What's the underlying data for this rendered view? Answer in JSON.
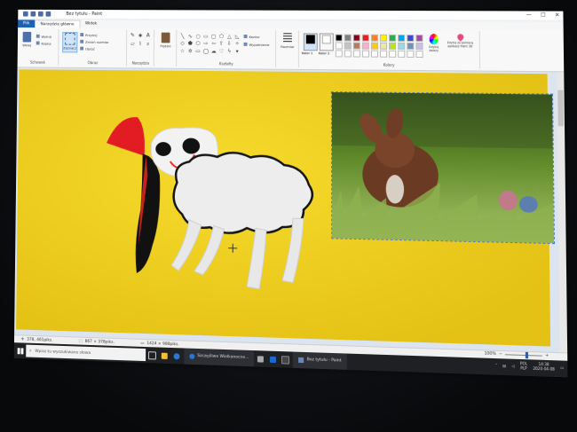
{
  "window": {
    "title": "Bez tytułu - Paint",
    "minimize_glyph": "—",
    "maximize_glyph": "☐",
    "close_glyph": "✕"
  },
  "tabs": [
    {
      "label": "Plik"
    },
    {
      "label": "Narzędzia główne"
    },
    {
      "label": "Widok"
    }
  ],
  "ribbon": {
    "clipboard": {
      "paste_label": "Wklej",
      "cut_label": "Wytnij",
      "copy_label": "Kopiuj",
      "group_label": "Schowek"
    },
    "image": {
      "select_label": "Zaznacz",
      "crop_label": "Przytnij",
      "resize_label": "Zmień rozmiar",
      "rotate_label": "Obróć",
      "group_label": "Obraz"
    },
    "tools": {
      "group_label": "Narzędzia"
    },
    "brushes": {
      "label": "Pędzle"
    },
    "shapes": {
      "outline_label": "Kontur",
      "fill_label": "Wypełnienie",
      "group_label": "Kształty"
    },
    "size": {
      "label": "Rozmiar"
    },
    "colors": {
      "color1_label": "Kolor 1",
      "color2_label": "Kolor 2",
      "edit_label": "Edytuj kolory",
      "paint3d_label": "Edytuj za pomocą aplikacji Paint 3D",
      "group_label": "Kolory",
      "color1": "#000000",
      "color2": "#ffffff",
      "palette": [
        "#000000",
        "#7f7f7f",
        "#880015",
        "#ed1c24",
        "#ff7f27",
        "#fff200",
        "#22b14c",
        "#00a2e8",
        "#3f48cc",
        "#a349a4",
        "#ffffff",
        "#c3c3c3",
        "#b97a57",
        "#ffaec9",
        "#ffc90e",
        "#efe4b0",
        "#b5e61d",
        "#99d9ea",
        "#7092be",
        "#c8bfe7",
        "#ffffff",
        "#ffffff",
        "#ffffff",
        "#ffffff",
        "#ffffff",
        "#ffffff",
        "#ffffff",
        "#ffffff",
        "#ffffff",
        "#ffffff"
      ]
    }
  },
  "canvas": {
    "background": "#f2d21f"
  },
  "status": {
    "cursor_pos": "378, 461piks.",
    "selection_size": "867 × 378piks.",
    "image_size": "1424 × 988piks.",
    "zoom": "100%"
  },
  "taskbar": {
    "search_placeholder": "Wpisz tu wyszukiwane słowa",
    "browser_app": "Szczęśliwe Wielkanocne...",
    "paint_app": "Bez tytułu - Paint",
    "lang_top": "POL",
    "lang_bottom": "PLP",
    "time": "14:38",
    "date": "2020-04-08"
  }
}
